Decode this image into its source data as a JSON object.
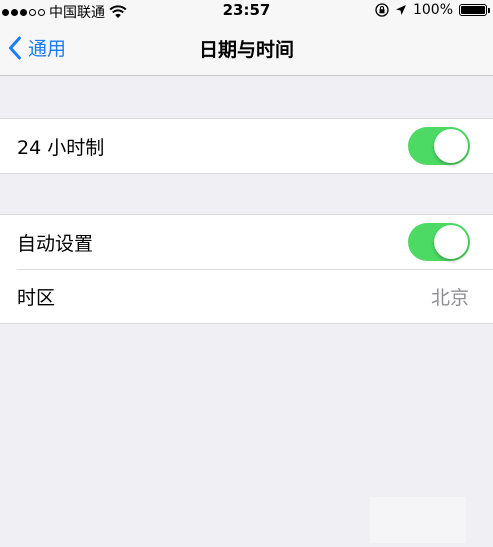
{
  "status_bar": {
    "signal_dots_filled": 3,
    "signal_dots_total": 5,
    "carrier": "中国联通",
    "time": "23:57",
    "battery_percent": "100%",
    "battery_level": 1.0,
    "icons": [
      "signal-icon",
      "wifi-icon",
      "orientation-lock-icon",
      "location-arrow-icon",
      "battery-icon"
    ]
  },
  "nav": {
    "back_label": "通用",
    "title": "日期与时间"
  },
  "groups": [
    {
      "rows": [
        {
          "label": "24 小时制",
          "toggle_on": true
        }
      ]
    },
    {
      "rows": [
        {
          "label": "自动设置",
          "toggle_on": true
        },
        {
          "label": "时区",
          "value": "北京"
        }
      ]
    }
  ],
  "colors": {
    "accent": "#1a7cf6",
    "toggle_on": "#4cd964",
    "background": "#efeff4",
    "secondary_text": "#8e8e93"
  }
}
